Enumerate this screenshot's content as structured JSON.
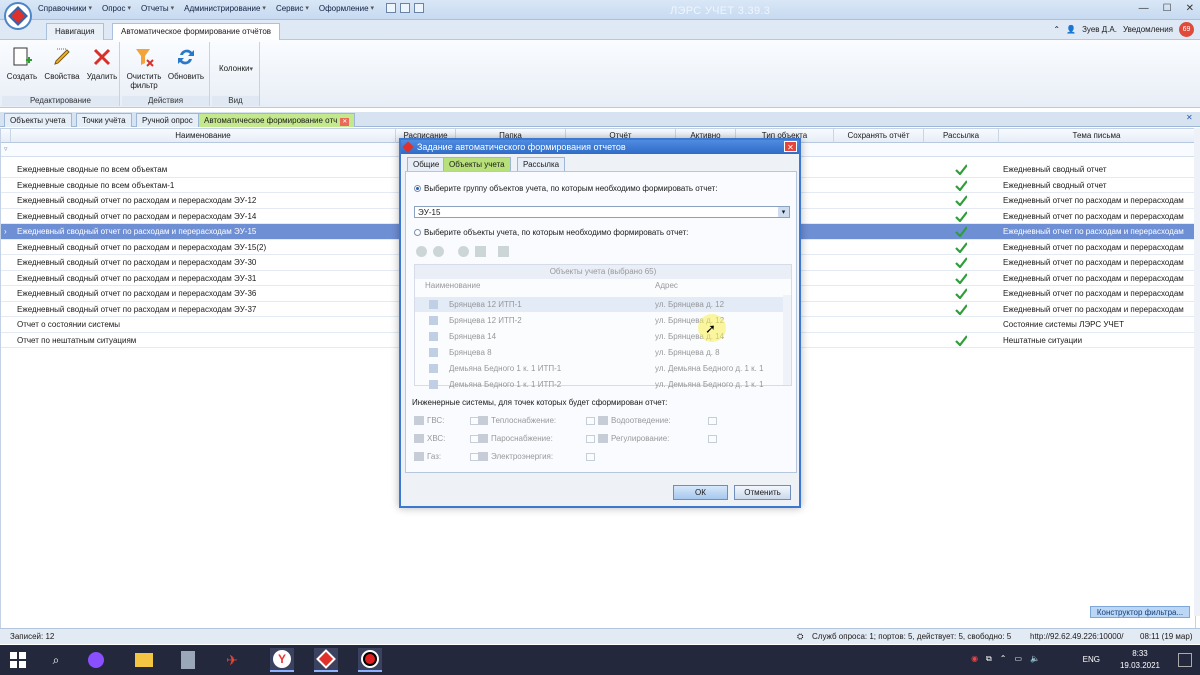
{
  "menu": [
    "Справочники",
    "Опрос",
    "Отчеты",
    "Администрирование",
    "Сервис",
    "Оформление"
  ],
  "app_title": "ЛЭРС УЧЕТ 3.39.3",
  "top_tabs": [
    "Навигация",
    "Автоматическое формирование отчётов"
  ],
  "user": {
    "name": "Зуев Д.А.",
    "notifications_label": "Уведомления",
    "notifications_count": "69"
  },
  "ribbon": {
    "groups": [
      {
        "label": "Редактирование",
        "buttons": [
          "Создать",
          "Свойства",
          "Удалить"
        ]
      },
      {
        "label": "Действия",
        "buttons": [
          "Очистить фильтр",
          "Обновить"
        ]
      },
      {
        "label": "Вид",
        "buttons": [
          "Колонки"
        ]
      }
    ]
  },
  "doc_tabs": [
    "Объекты учета",
    "Точки учёта",
    "Ручной опрос",
    "Автоматическое формирование отч"
  ],
  "grid": {
    "columns": [
      "Наименование",
      "Расписание",
      "Папка",
      "Отчёт",
      "Активно",
      "Тип объекта",
      "Сохранять отчёт",
      "Рассылка",
      "Тема письма"
    ],
    "rows": [
      {
        "name": "Ежедневные сводные по всем объектам",
        "mailing": true,
        "subject": "Ежедневный сводный отчет"
      },
      {
        "name": "Ежедневные сводные по всем объектам-1",
        "mailing": true,
        "subject": "Ежедневный сводный отчет"
      },
      {
        "name": "Ежедневный сводный отчет по расходам и перерасходам ЭУ-12",
        "mailing": true,
        "subject": "Ежедневный  отчет по расходам и перерасходам"
      },
      {
        "name": "Ежедневный сводный отчет по расходам и перерасходам ЭУ-14",
        "mailing": true,
        "subject": "Ежедневный  отчет по расходам и перерасходам"
      },
      {
        "name": "Ежедневный сводный отчет по расходам и перерасходам ЭУ-15",
        "mailing": true,
        "subject": "Ежедневный  отчет по расходам и перерасходам",
        "selected": true
      },
      {
        "name": "Ежедневный сводный отчет по расходам и перерасходам ЭУ-15(2)",
        "mailing": true,
        "subject": "Ежедневный  отчет по расходам и перерасходам"
      },
      {
        "name": "Ежедневный сводный отчет по расходам и перерасходам ЭУ-30",
        "mailing": true,
        "subject": "Ежедневный  отчет по расходам и перерасходам"
      },
      {
        "name": "Ежедневный сводный отчет по расходам и перерасходам ЭУ-31",
        "mailing": true,
        "subject": "Ежедневный  отчет по расходам и перерасходам"
      },
      {
        "name": "Ежедневный сводный отчет по расходам и перерасходам ЭУ-36",
        "mailing": true,
        "subject": "Ежедневный  отчет по расходам и перерасходам"
      },
      {
        "name": "Ежедневный сводный отчет по расходам и перерасходам ЭУ-37",
        "mailing": true,
        "subject": "Ежедневный  отчет по расходам и перерасходам"
      },
      {
        "name": "Отчет о состоянии системы",
        "mailing": false,
        "subject": "Состояние системы ЛЭРС УЧЕТ"
      },
      {
        "name": "Отчет по нештатным ситуациям",
        "mailing": true,
        "subject": "Нештатные ситуации"
      }
    ]
  },
  "constructor_button": "Конструктор фильтра...",
  "status": {
    "records": "Записей: 12",
    "services": "Служб опроса: 1; портов: 5, действует: 5, свободно: 5",
    "server": "http://92.62.49.226:10000/",
    "time": "08:11 (19 мар)"
  },
  "dialog": {
    "title": "Задание автоматического формирования отчетов",
    "tabs": [
      "Общие",
      "Объекты учета",
      "Рассылка"
    ],
    "radio_group": "Выберите группу объектов учета, по которым необходимо формировать отчет:",
    "group_value": "ЭУ-15",
    "radio_objects": "Выберите объекты учета, по которым необходимо формировать отчет:",
    "objects_header": "Объекты учета (выбрано 65)",
    "objects_cols": [
      "Наименование",
      "Адрес"
    ],
    "objects_rows": [
      {
        "name": "Брянцева 12 ИТП-1",
        "addr": "ул. Брянцева д. 12"
      },
      {
        "name": "Брянцева 12 ИТП-2",
        "addr": "ул. Брянцева д. 12"
      },
      {
        "name": "Брянцева 14",
        "addr": "ул. Брянцева д. 14"
      },
      {
        "name": "Брянцева 8",
        "addr": "ул. Брянцева д. 8"
      },
      {
        "name": "Демьяна Бедного 1 к. 1 ИТП-1",
        "addr": "ул. Демьяна Бедного д. 1 к. 1"
      },
      {
        "name": "Демьяна Бедного 1 к. 1 ИТП-2",
        "addr": "ул. Демьяна Бедного д. 1 к. 1"
      }
    ],
    "eng_label": "Инженерные системы, для точек которых будет сформирован отчет:",
    "systems": [
      "ГВС:",
      "Теплоснабжение:",
      "Водоотведение:",
      "ХВС:",
      "Пароснабжение:",
      "Регулирование:",
      "Газ:",
      "Электроэнергия:"
    ],
    "ok": "ОК",
    "cancel": "Отменить"
  },
  "taskbar": {
    "lang": "ENG",
    "time": "8:33",
    "date": "19.03.2021"
  }
}
